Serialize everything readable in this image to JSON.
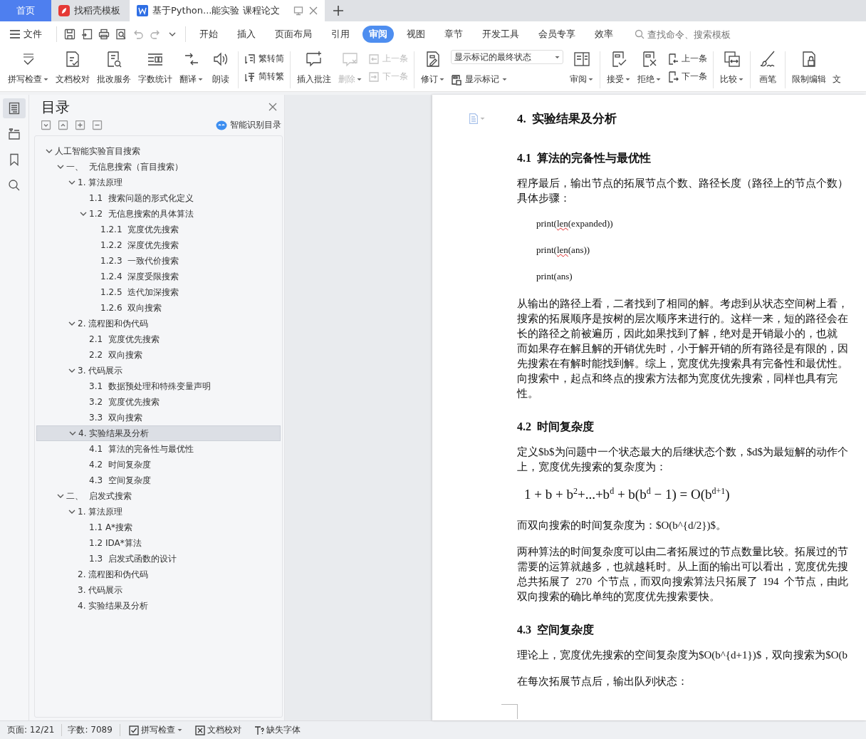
{
  "tabs": [
    {
      "label": "首页",
      "kind": "home",
      "selected": false
    },
    {
      "label": "找稻壳模板",
      "kind": "docer",
      "selected": false
    },
    {
      "label": "基于Python...能实验 课程论文",
      "kind": "doc",
      "selected": true
    }
  ],
  "menu": {
    "file": "文件",
    "tabs": [
      {
        "label": "开始",
        "selected": false
      },
      {
        "label": "插入",
        "selected": false
      },
      {
        "label": "页面布局",
        "selected": false
      },
      {
        "label": "引用",
        "selected": false
      },
      {
        "label": "审阅",
        "selected": true
      },
      {
        "label": "视图",
        "selected": false
      },
      {
        "label": "章节",
        "selected": false
      },
      {
        "label": "开发工具",
        "selected": false
      },
      {
        "label": "会员专享",
        "selected": false
      },
      {
        "label": "效率",
        "selected": false
      }
    ],
    "search": {
      "placeholder": "查找命令、搜索模板"
    }
  },
  "ribbon": [
    {
      "kind": "large",
      "label": "拼写检查",
      "menu": true,
      "disabled": false
    },
    {
      "kind": "large",
      "label": "文档校对",
      "menu": false,
      "disabled": false
    },
    {
      "kind": "large",
      "label": "批改服务",
      "menu": false,
      "disabled": false
    },
    {
      "kind": "large",
      "label": "字数统计",
      "menu": false,
      "disabled": false
    },
    {
      "kind": "large",
      "label": "翻译",
      "menu": true,
      "disabled": false
    },
    {
      "kind": "large",
      "label": "朗读",
      "menu": false,
      "disabled": false
    },
    {
      "kind": "separator"
    },
    {
      "kind": "stack",
      "items": [
        {
          "label": "繁转简",
          "disabled": false
        },
        {
          "label": "简转繁",
          "disabled": false
        }
      ]
    },
    {
      "kind": "separator"
    },
    {
      "kind": "large",
      "label": "插入批注",
      "menu": false,
      "disabled": false
    },
    {
      "kind": "large",
      "label": "删除",
      "menu": true,
      "disabled": true
    },
    {
      "kind": "stack",
      "items": [
        {
          "label": "上一条",
          "disabled": true
        },
        {
          "label": "下一条",
          "disabled": true
        }
      ]
    },
    {
      "kind": "separator"
    },
    {
      "kind": "large",
      "label": "修订",
      "menu": true,
      "disabled": false
    },
    {
      "kind": "markup",
      "select": "显示标记的最终状态",
      "label": "显示标记",
      "menu": true
    },
    {
      "kind": "large",
      "label": "审阅",
      "menu": true,
      "disabled": false
    },
    {
      "kind": "separator"
    },
    {
      "kind": "large",
      "label": "接受",
      "menu": true,
      "disabled": false
    },
    {
      "kind": "large",
      "label": "拒绝",
      "menu": true,
      "disabled": false
    },
    {
      "kind": "stack",
      "items": [
        {
          "label": "上一条",
          "disabled": false
        },
        {
          "label": "下一条",
          "disabled": false
        }
      ]
    },
    {
      "kind": "separator"
    },
    {
      "kind": "large",
      "label": "比较",
      "menu": true,
      "disabled": false
    },
    {
      "kind": "separator"
    },
    {
      "kind": "large",
      "label": "画笔",
      "menu": false,
      "disabled": false
    },
    {
      "kind": "separator"
    },
    {
      "kind": "large",
      "label": "限制编辑",
      "menu": false,
      "disabled": false
    },
    {
      "kind": "cut",
      "label": "文"
    }
  ],
  "nav": {
    "rail": [
      {
        "selected": true
      },
      {
        "selected": false
      },
      {
        "selected": false
      },
      {
        "selected": false
      }
    ],
    "title": "目录",
    "smart_button": "智能识别目录",
    "toc": [
      {
        "label": "人工智能实验盲目搜索",
        "expanded": true,
        "selected": false,
        "children": [
          {
            "label": "一、  无信息搜索（盲目搜索）",
            "expanded": true,
            "selected": false,
            "children": [
              {
                "label": "1. 算法原理",
                "expanded": true,
                "selected": false,
                "children": [
                  {
                    "label": "1.1  搜索问题的形式化定义",
                    "selected": false
                  },
                  {
                    "label": "1.2  无信息搜索的具体算法",
                    "expanded": true,
                    "selected": false,
                    "children": [
                      {
                        "label": "1.2.1  宽度优先搜索",
                        "selected": false
                      },
                      {
                        "label": "1.2.2  深度优先搜索",
                        "selected": false
                      },
                      {
                        "label": "1.2.3  一致代价搜索",
                        "selected": false
                      },
                      {
                        "label": "1.2.4  深度受限搜索",
                        "selected": false
                      },
                      {
                        "label": "1.2.5  迭代加深搜索",
                        "selected": false
                      },
                      {
                        "label": "1.2.6  双向搜索",
                        "selected": false
                      }
                    ]
                  }
                ]
              },
              {
                "label": "2. 流程图和伪代码",
                "expanded": true,
                "selected": false,
                "children": [
                  {
                    "label": "2.1  宽度优先搜索",
                    "selected": false
                  },
                  {
                    "label": "2.2  双向搜索",
                    "selected": false
                  }
                ]
              },
              {
                "label": "3. 代码展示",
                "expanded": true,
                "selected": false,
                "children": [
                  {
                    "label": "3.1  数据预处理和特殊变量声明",
                    "selected": false
                  },
                  {
                    "label": "3.2  宽度优先搜索",
                    "selected": false
                  },
                  {
                    "label": "3.3  双向搜索",
                    "selected": false
                  }
                ]
              },
              {
                "label": "4. 实验结果及分析",
                "expanded": true,
                "selected": true,
                "children": [
                  {
                    "label": "4.1  算法的完备性与最优性",
                    "selected": false
                  },
                  {
                    "label": "4.2  时间复杂度",
                    "selected": false
                  },
                  {
                    "label": "4.3  空间复杂度",
                    "selected": false
                  }
                ]
              }
            ]
          },
          {
            "label": "二、  启发式搜索",
            "expanded": true,
            "selected": false,
            "children": [
              {
                "label": "1. 算法原理",
                "expanded": true,
                "selected": false,
                "children": [
                  {
                    "label": "1.1 A*搜索",
                    "selected": false
                  },
                  {
                    "label": "1.2 IDA*算法",
                    "selected": false
                  },
                  {
                    "label": "1.3  启发式函数的设计",
                    "selected": false
                  }
                ]
              },
              {
                "label": "2. 流程图和伪代码",
                "selected": false
              },
              {
                "label": "3. 代码展示",
                "selected": false
              },
              {
                "label": "4. 实验结果及分析",
                "selected": false
              }
            ]
          }
        ]
      }
    ]
  },
  "document": {
    "blocks": [
      {
        "kind": "h1",
        "text": "4.  实验结果及分析"
      },
      {
        "kind": "h2",
        "text": "4.1  算法的完备性与最优性"
      },
      {
        "kind": "para",
        "lines": [
          "程序最后，输出节点的拓展节点个数、路径长度（路径上的节点个数）",
          "具体步骤："
        ]
      },
      {
        "kind": "code",
        "before": "print(",
        "flagged": "len",
        "after": "(expanded))"
      },
      {
        "kind": "code",
        "before": "print(",
        "flagged": "len",
        "after": "(ans))"
      },
      {
        "kind": "code",
        "before": "print(ans)"
      },
      {
        "kind": "para",
        "lines": [
          "从输出的路径上看，二者找到了相同的解。考虑到从状态空间树上看，",
          "搜索的拓展顺序是按树的层次顺序来进行的。这样一来，短的路径会在",
          "长的路径之前被遍历，因此如果找到了解，绝对是开销最小的，也就",
          "而如果存在解且解的开销优先时，小于解开销的所有路径是有限的，因",
          "先搜索在有解时能找到解。综上，宽度优先搜索具有完备性和最优性。",
          "向搜索中，起点和终点的搜索方法都为宽度优先搜索，同样也具有完",
          "性。"
        ]
      },
      {
        "kind": "h2",
        "text": "4.2  时间复杂度"
      },
      {
        "kind": "para",
        "lines": [
          "定义$b$为问题中一个状态最大的后继状态个数，$d$为最短解的动作个",
          "上，宽度优先搜索的复杂度为："
        ]
      },
      {
        "kind": "formula",
        "text": "1 + b + b$^{2}$+...+b$^{d}$ + b(b$^{d}$ − 1) = O(b$^{d+1}$)"
      },
      {
        "kind": "para",
        "lines": [
          "而双向搜索的时间复杂度为：$O(b^{d/2})$。"
        ]
      },
      {
        "kind": "para",
        "lines": [
          "两种算法的时间复杂度可以由二者拓展过的节点数量比较。拓展过的节",
          "需要的运算就越多，也就越耗时。从上面的输出可以看出，宽度优先搜",
          "总共拓展了  270  个节点，而双向搜索算法只拓展了  194  个节点，由此",
          "双向搜索的确比单纯的宽度优先搜索要快。"
        ]
      },
      {
        "kind": "h2",
        "text": "4.3  空间复杂度"
      },
      {
        "kind": "para",
        "lines": [
          "理论上，宽度优先搜索的空间复杂度为$O(b^{d+1})$，双向搜索为$O(b"
        ]
      },
      {
        "kind": "para",
        "lines": [
          "在每次拓展节点后，输出队列状态："
        ]
      }
    ]
  },
  "status": [
    {
      "kind": "text",
      "label": "页面: 12/21"
    },
    {
      "kind": "text",
      "label": "字数: 7089"
    },
    {
      "kind": "toggle",
      "label": "拼写检查",
      "menu": true
    },
    {
      "kind": "toggle",
      "label": "文档校对",
      "menu": false
    },
    {
      "kind": "toggle",
      "label": "缺失字体",
      "menu": false
    }
  ]
}
